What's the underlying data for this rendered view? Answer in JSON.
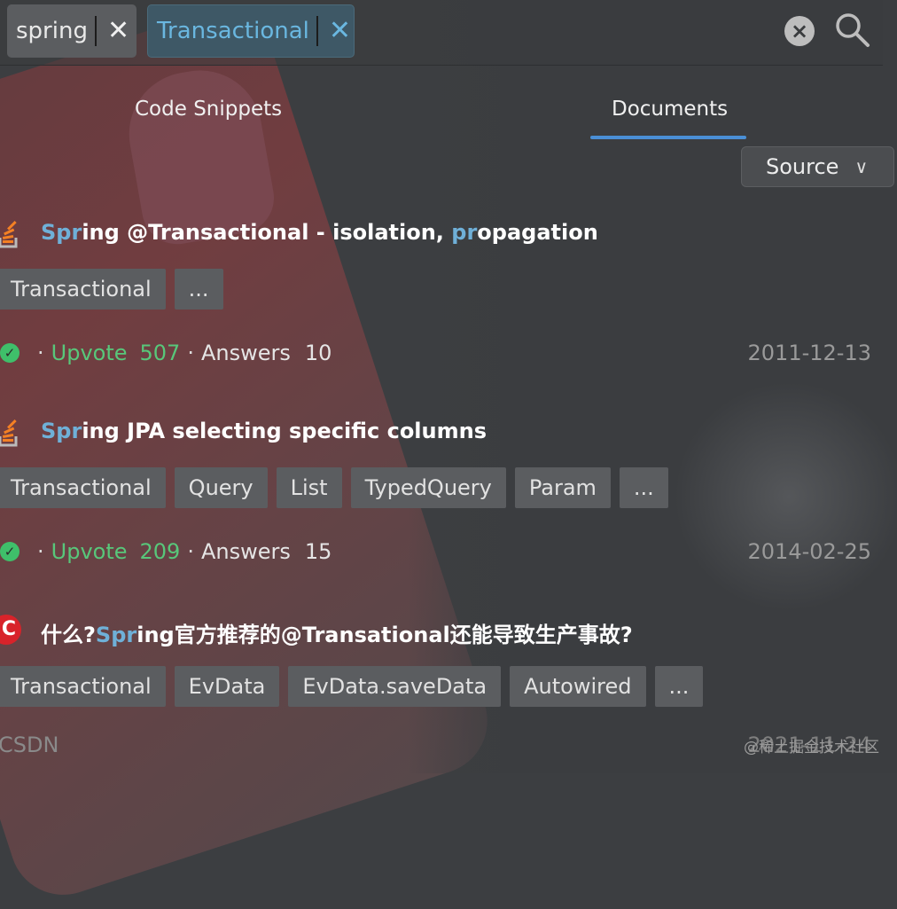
{
  "search": {
    "tokens": [
      {
        "label": "spring"
      },
      {
        "label": "Transactional"
      }
    ],
    "clear_glyph": "×",
    "token_close_glyph": "✕"
  },
  "tabs": [
    {
      "label": "Code Snippets",
      "active": false
    },
    {
      "label": "Documents",
      "active": true
    }
  ],
  "filter": {
    "label": "Source",
    "chevron": "∨"
  },
  "results": [
    {
      "title_hl1": "Spr",
      "title_mid": "ing @Transactional - isolation, ",
      "title_hl2": "pr",
      "title_end": "opagation",
      "icon": "stackoverflow-icon",
      "tags": [
        "Transactional",
        "..."
      ],
      "check_glyph": "✓",
      "sep": "·",
      "upvote_label": "Upvote",
      "upvote_count": "507",
      "answers_label": "Answers",
      "answers_count": "10",
      "date": "2011-12-13"
    },
    {
      "title_hl1": "Spr",
      "title_mid": "ing JPA selecting specific columns",
      "icon": "stackoverflow-icon",
      "tags": [
        "Transactional",
        "Query",
        "List",
        "TypedQuery",
        "Param",
        "..."
      ],
      "check_glyph": "✓",
      "sep": "·",
      "upvote_label": "Upvote",
      "upvote_count": "209",
      "answers_label": "Answers",
      "answers_count": "15",
      "date": "2014-02-25"
    },
    {
      "title_pre": "什么?",
      "title_hl1": "Spr",
      "title_mid": "ing官方推荐的@Transational还能导致生产事故?",
      "icon": "csdn-icon",
      "icon_glyph": "C",
      "tags": [
        "Transactional",
        "EvData",
        "EvData.saveData",
        "Autowired",
        "..."
      ],
      "source": "CSDN",
      "date": "2021-11-24"
    }
  ],
  "watermark": "@稀土掘金技术社区",
  "colors": {
    "highlight": "#6fb0d8",
    "upvote": "#58c77a",
    "tab_underline": "#4a8fd6",
    "so_orange": "#f48024",
    "csdn_red": "#d8232a"
  }
}
